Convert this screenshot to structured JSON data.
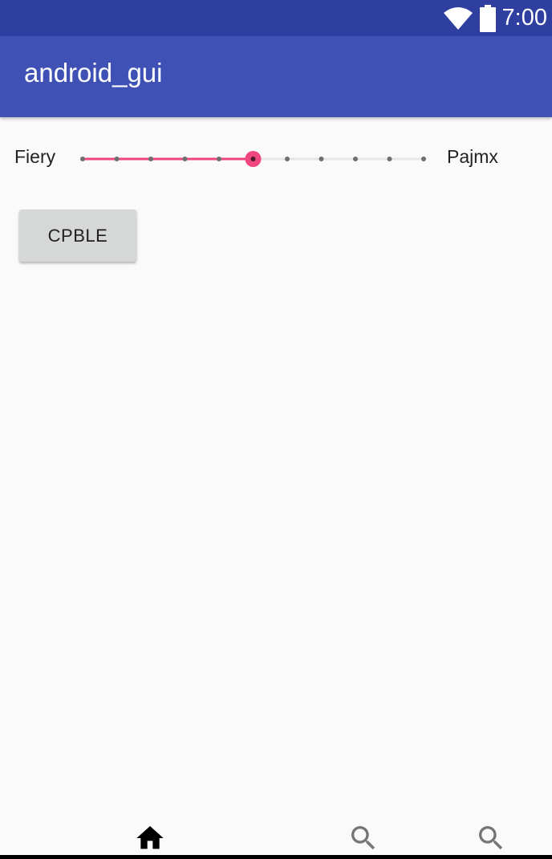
{
  "status_bar": {
    "time": "7:00",
    "icons": [
      "wifi-icon",
      "battery-icon"
    ],
    "color": "#2f3fa0"
  },
  "app_bar": {
    "title": "android_gui",
    "color": "#3f51b5"
  },
  "slider": {
    "label_left": "Fiery",
    "label_right": "Pajmx",
    "min": 0,
    "max": 10,
    "value": 5,
    "accent_color": "#f0467e"
  },
  "button": {
    "label": "CPBLE"
  },
  "bottom_nav": {
    "items": [
      {
        "icon": "home-icon",
        "active": true
      },
      {
        "icon": "search-icon",
        "active": false
      },
      {
        "icon": "search-icon",
        "active": false
      }
    ]
  }
}
